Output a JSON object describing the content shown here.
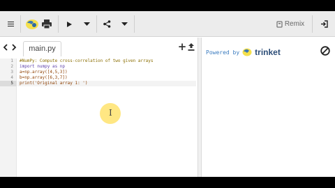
{
  "toolbar": {
    "remix_label": "Remix",
    "icons": [
      "menu-icon",
      "python-logo-icon",
      "printer-icon",
      "play-icon",
      "chevron-down-icon",
      "share-icon",
      "chevron-down-icon",
      "remix-icon",
      "login-icon"
    ]
  },
  "editor": {
    "file_tab": "main.py",
    "line_numbers": [
      "1",
      "2",
      "3",
      "4",
      "5"
    ],
    "active_line": 5,
    "code_lines": [
      "#NumPy: Compute cross-correlation of two given arrays",
      "import numpy as np",
      "a=np.array([4,5,3])",
      "b=np.array([6,3,7])",
      "print('Original array 1: ')"
    ]
  },
  "output": {
    "powered_by": "Powered by",
    "brand": "trinket"
  },
  "colors": {
    "toolbar_bg": "#ececec",
    "comment": "#8a6d00",
    "keyword": "#5a3ea8",
    "code": "#8e3f00",
    "powered_by": "#3a7bbf",
    "brand": "#2d4e78",
    "cursor_highlight": "#ffe36e"
  }
}
